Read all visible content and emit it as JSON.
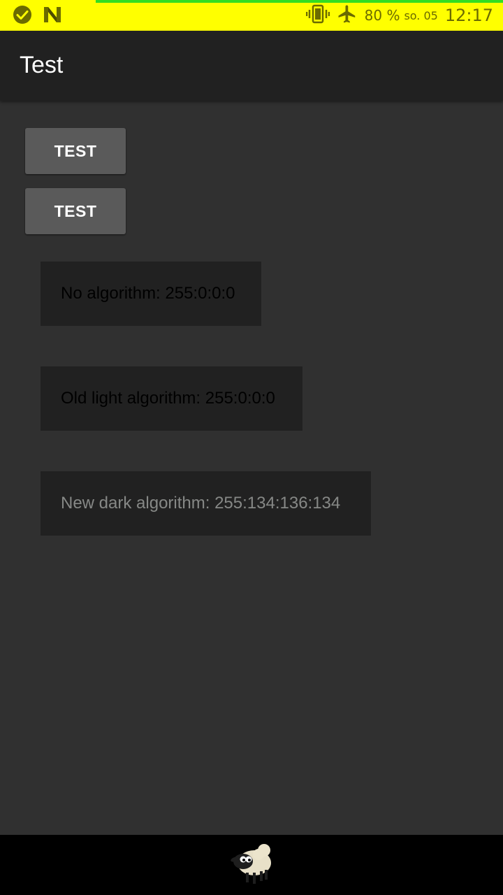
{
  "status_bar": {
    "battery": "80 %",
    "date": "so. 05",
    "time": "12:17",
    "background_color": "#ffff00",
    "icons_left": [
      "check-circle-icon",
      "n-logo-icon"
    ],
    "icons_right": [
      "vibrate-icon",
      "airplane-mode-icon"
    ]
  },
  "app_bar": {
    "title": "Test"
  },
  "buttons": [
    {
      "label": "TEST"
    },
    {
      "label": "TEST"
    }
  ],
  "results": [
    {
      "text": "No algorithm: 255:0:0:0",
      "color": "#000000"
    },
    {
      "text": "Old light algorithm: 255:0:0:0",
      "color": "#000000"
    },
    {
      "text": "New dark algorithm: 255:134:136:134",
      "color": "#868886"
    }
  ],
  "nav_bar": {
    "icon": "sheep-icon"
  }
}
